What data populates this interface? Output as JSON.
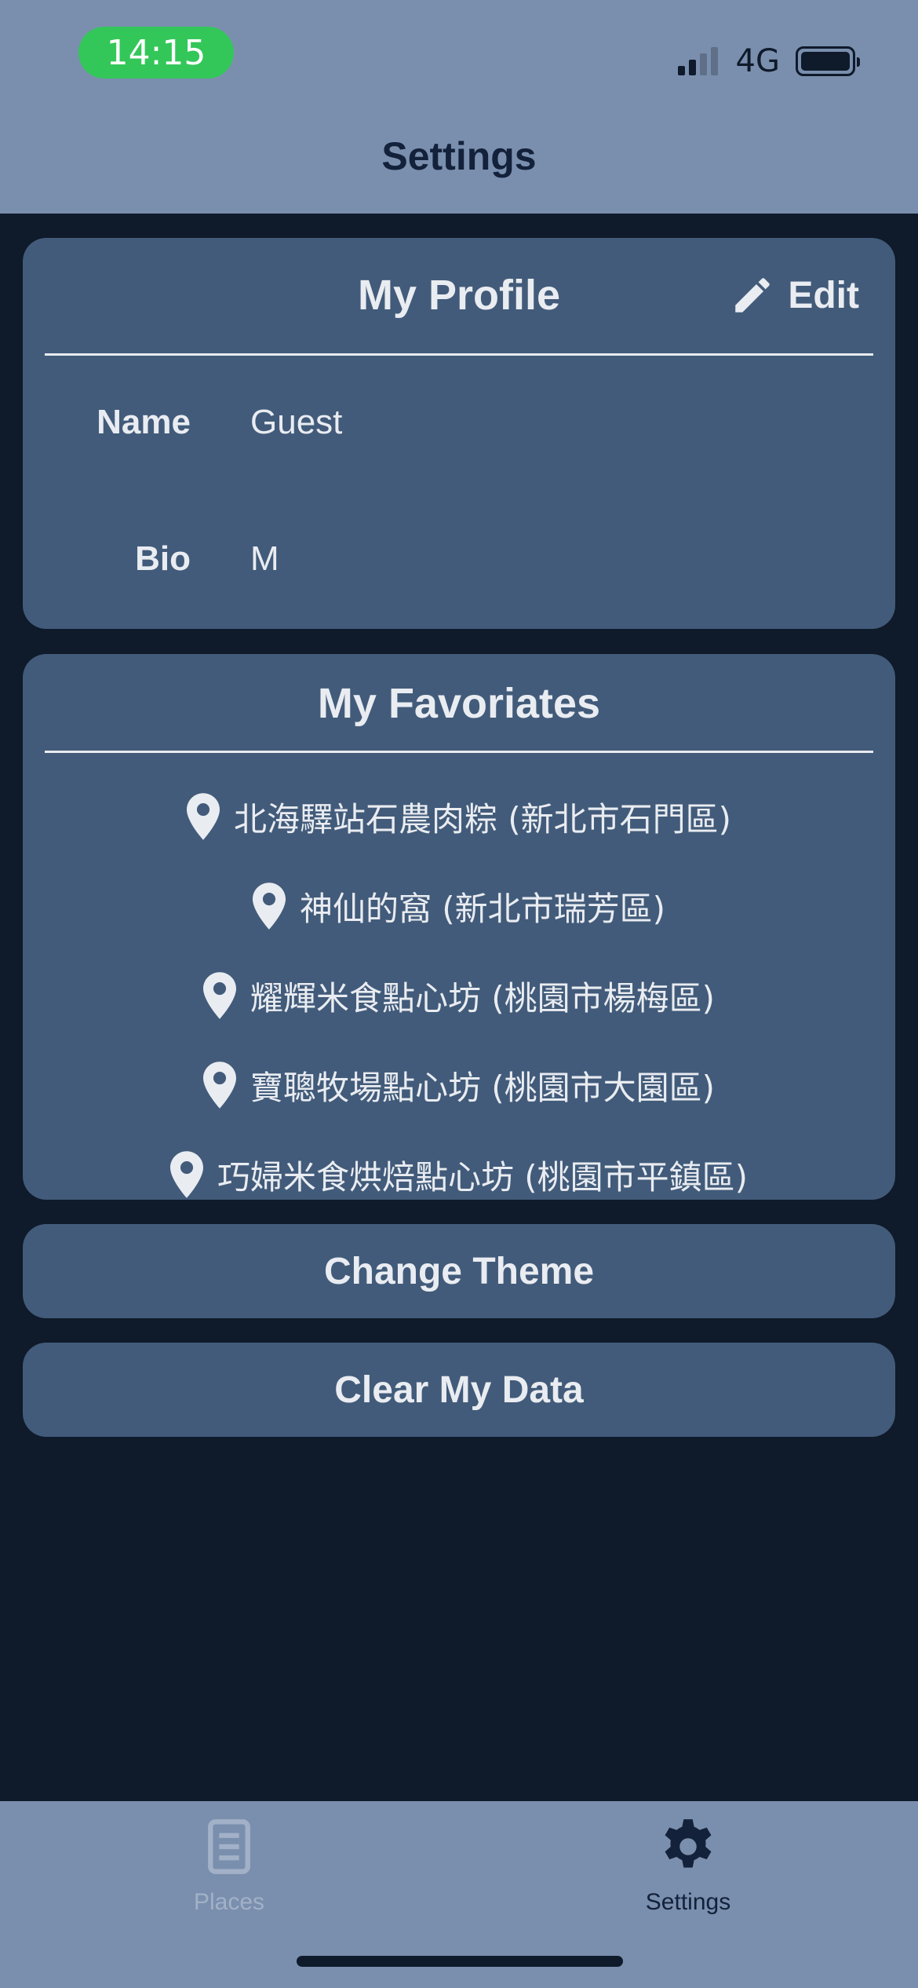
{
  "status_bar": {
    "time": "14:15",
    "network": "4G",
    "signal_bars_active": 2,
    "signal_bars_total": 4,
    "battery_level": 1.0
  },
  "header": {
    "title": "Settings"
  },
  "profile": {
    "title": "My Profile",
    "edit_label": "Edit",
    "edit_icon": "pencil-icon",
    "name_label": "Name",
    "name_value": "Guest",
    "bio_label": "Bio",
    "bio_value": "M"
  },
  "favorites": {
    "title": "My Favoriates",
    "item_icon": "map-pin-icon",
    "items": [
      "北海驛站石農肉粽 (新北市石門區)",
      "神仙的窩 (新北市瑞芳區)",
      "耀輝米食點心坊 (桃園市楊梅區)",
      "寶聰牧場點心坊 (桃園市大園區)",
      "巧婦米食烘焙點心坊 (桃園市平鎮區)"
    ]
  },
  "actions": {
    "change_theme": "Change Theme",
    "clear_data": "Clear My Data"
  },
  "tab_bar": {
    "tabs": [
      {
        "label": "Places",
        "icon": "document-icon",
        "active": false
      },
      {
        "label": "Settings",
        "icon": "gear-icon",
        "active": true
      }
    ]
  },
  "colors": {
    "header_bg": "#7a8fae",
    "page_bg": "#0f1a2a",
    "card_bg": "#425b7a",
    "time_pill": "#33c759",
    "text_light": "#e9ecf1",
    "text_dark": "#13213a"
  }
}
